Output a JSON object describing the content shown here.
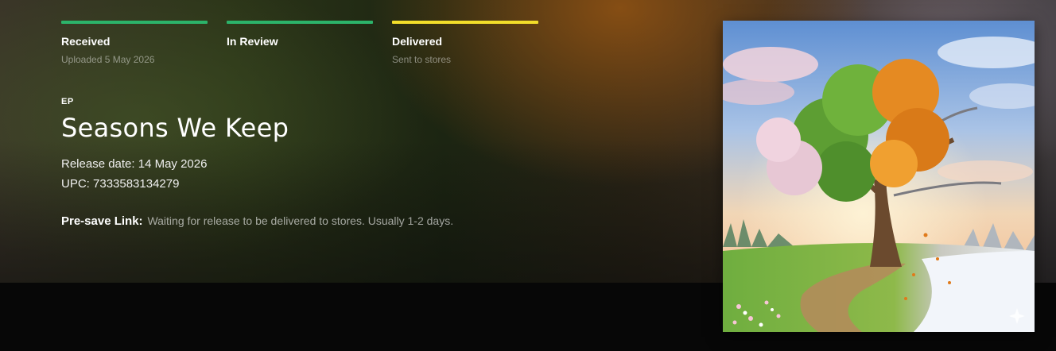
{
  "stages": [
    {
      "name": "Received",
      "sub": "Uploaded 5 May 2026",
      "color": "#2cb36a"
    },
    {
      "name": "In Review",
      "sub": "",
      "color": "#2cb36a"
    },
    {
      "name": "Delivered",
      "sub": "Sent to stores",
      "color": "#f2dd2a"
    }
  ],
  "release": {
    "type": "EP",
    "title": "Seasons We Keep",
    "release_date": "Release date: 14 May 2026",
    "upc": "UPC: 7333583134279"
  },
  "presave": {
    "label": "Pre-save Link:",
    "text": "Waiting for release to be delivered to stores. Usually 1-2 days."
  },
  "cover": {
    "icon": "sparkle-icon"
  }
}
